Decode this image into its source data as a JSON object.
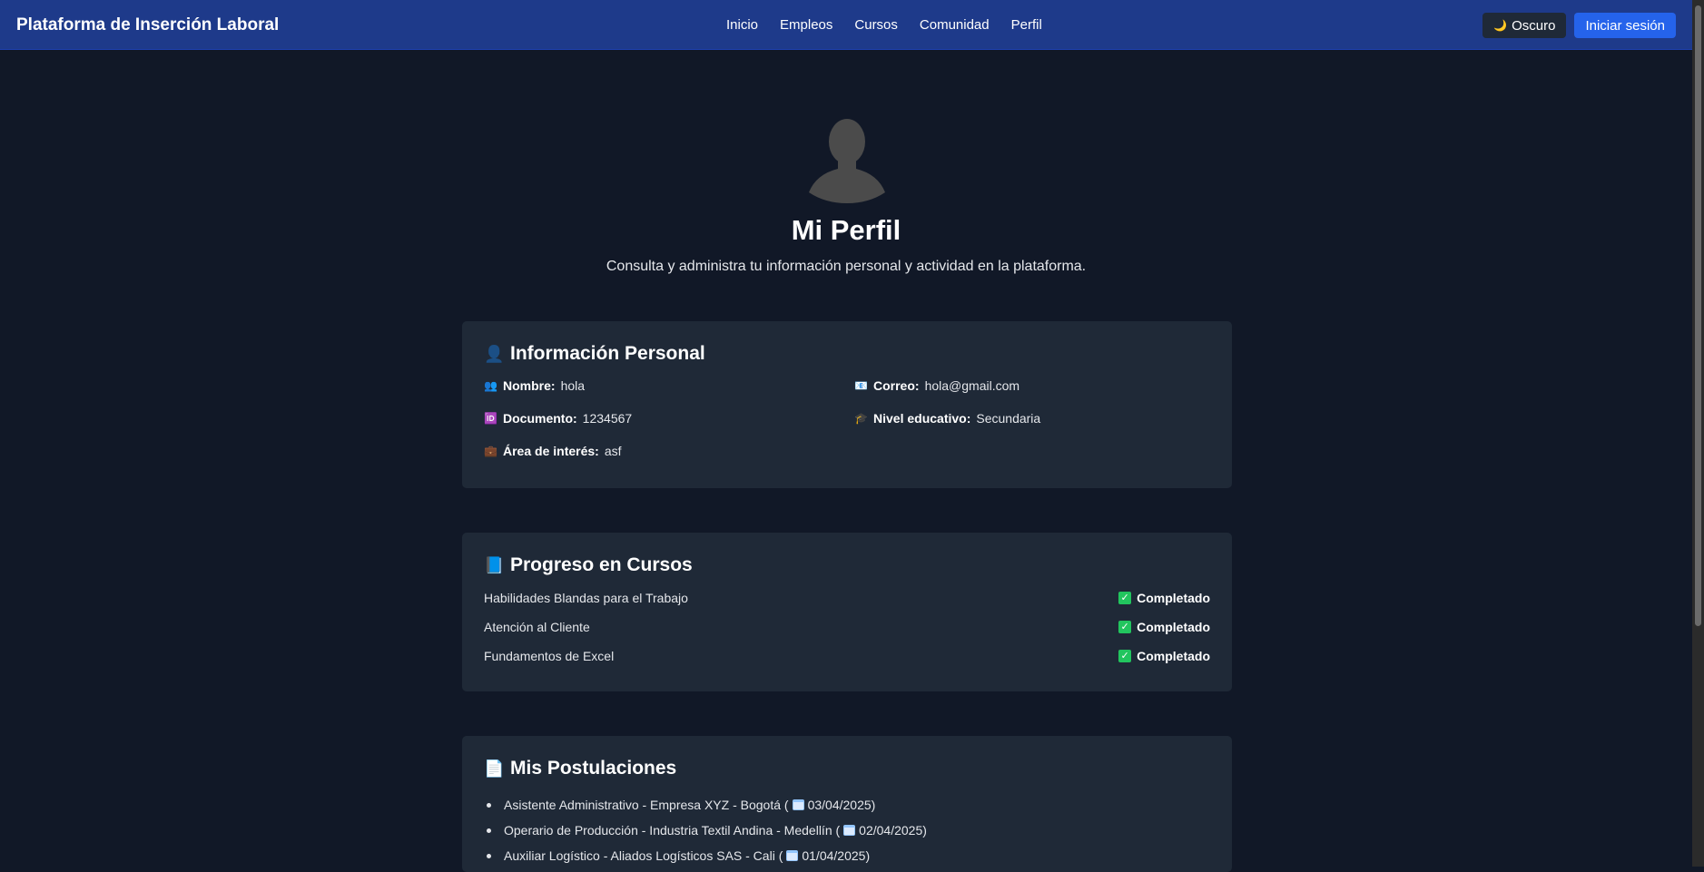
{
  "nav": {
    "brand": "Plataforma de Inserción Laboral",
    "links": [
      "Inicio",
      "Empleos",
      "Cursos",
      "Comunidad",
      "Perfil"
    ],
    "theme_icon": "🌙",
    "theme_label": "Oscuro",
    "login_label": "Iniciar sesión"
  },
  "header": {
    "title": "Mi Perfil",
    "subtitle": "Consulta y administra tu información personal y actividad en la plataforma."
  },
  "personal": {
    "icon": "👤",
    "title": "Información Personal",
    "items": [
      {
        "icon": "👥",
        "label": "Nombre:",
        "value": "hola"
      },
      {
        "icon": "📧",
        "label": "Correo:",
        "value": "hola@gmail.com"
      },
      {
        "icon": "🆔",
        "label": "Documento:",
        "value": "1234567"
      },
      {
        "icon": "🎓",
        "label": "Nivel educativo:",
        "value": "Secundaria"
      },
      {
        "icon": "💼",
        "label": "Área de interés:",
        "value": "asf"
      }
    ]
  },
  "courses": {
    "icon": "📘",
    "title": "Progreso en Cursos",
    "items": [
      {
        "name": "Habilidades Blandas para el Trabajo",
        "status": "Completado"
      },
      {
        "name": "Atención al Cliente",
        "status": "Completado"
      },
      {
        "name": "Fundamentos de Excel",
        "status": "Completado"
      }
    ]
  },
  "applications": {
    "icon": "📄",
    "title": "Mis Postulaciones",
    "items": [
      {
        "text": "Asistente Administrativo - Empresa XYZ - Bogotá (",
        "date": "03/04/2025",
        "close": ")"
      },
      {
        "text": "Operario de Producción - Industria Textil Andina - Medellín (",
        "date": "02/04/2025",
        "close": ")"
      },
      {
        "text": "Auxiliar Logístico - Aliados Logísticos SAS - Cali (",
        "date": "01/04/2025",
        "close": ")"
      }
    ]
  }
}
